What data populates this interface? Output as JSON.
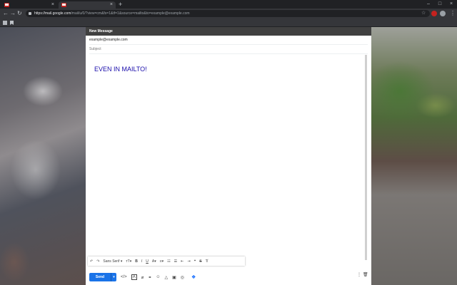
{
  "browser": {
    "tabs": [
      {
        "label": "",
        "close": "×"
      },
      {
        "label": "",
        "close": "×"
      }
    ],
    "new_tab": "+",
    "window_controls": [
      "–",
      "□",
      "×"
    ],
    "nav": {
      "back": "←",
      "forward": "→",
      "reload": "↻"
    },
    "url_host": "https://mail.google.com",
    "url_path": "/mail/u/0/?view=cm&fs=1&tf=1&source=mailto&to=example@example.com",
    "star": "☆",
    "menu": "⋮"
  },
  "compose": {
    "title": "New Message",
    "to_value": "example@example.com",
    "subject_placeholder": "Subject",
    "body_text": "EVEN IN MAILTO!",
    "send_label": "Send",
    "send_menu": "▾",
    "more": "⋮",
    "trash": "🗑",
    "toolbar": {
      "undo": "↶",
      "redo": "↷",
      "font": "Sans Serif",
      "font_arrow": "▾",
      "size": "тT▾",
      "bold": "B",
      "italic": "I",
      "underline": "U",
      "text_color": "A▾",
      "align": "≡▾",
      "numbered_list": "☷",
      "bulleted_list": "☰",
      "indent_less": "⇤",
      "indent_more": "⇥",
      "quote": "❝",
      "strikethrough": "S",
      "clear_format": "T̸"
    },
    "send_icons": {
      "code": "</>",
      "formatting": "A",
      "attach": "⌀",
      "link": "⚭",
      "emoji": "☺",
      "drive": "△",
      "photo": "▣",
      "lock": "◎",
      "dropbox": "❖"
    }
  },
  "colors": {
    "accent": "#1a73e8",
    "body_text": "#1a0dab",
    "header": "#404040"
  }
}
